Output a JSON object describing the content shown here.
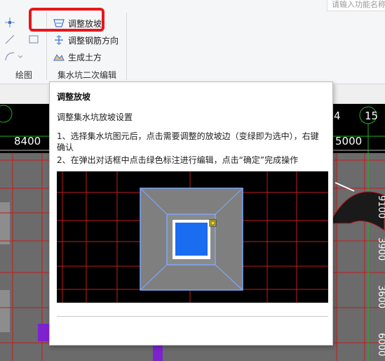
{
  "search": {
    "placeholder": "请输入功能名称"
  },
  "ribbon": {
    "groups": [
      {
        "label": "绘图"
      },
      {
        "label": "集水坑二次编辑"
      }
    ],
    "commands": [
      {
        "label": "调整放坡",
        "icon": "slope-adjust-icon"
      },
      {
        "label": "调整钢筋方向",
        "icon": "rebar-direction-icon"
      },
      {
        "label": "生成土方",
        "icon": "earthwork-icon"
      }
    ]
  },
  "canvas": {
    "axis_labels": [
      "8400",
      "5000"
    ],
    "axis_numbers": [
      "4",
      "15"
    ],
    "side_dims": [
      "9100",
      "3900",
      "3600",
      "6000"
    ]
  },
  "tooltip": {
    "title": "调整放坡",
    "subtitle": "调整集水坑放坡设置",
    "step1": "1、选择集水坑图元后，点击需要调整的放坡边（变绿即为选中），右键确认",
    "step2": "2、在弹出对话框中点击绿色标注进行编辑，点击“确定”完成操作"
  },
  "colors": {
    "highlight": "#e8171b",
    "canvas_bg": "#000000",
    "grid": "#c21d1d",
    "pit_fill": "#1a6cf0",
    "slope_line": "#7ea7f5"
  }
}
